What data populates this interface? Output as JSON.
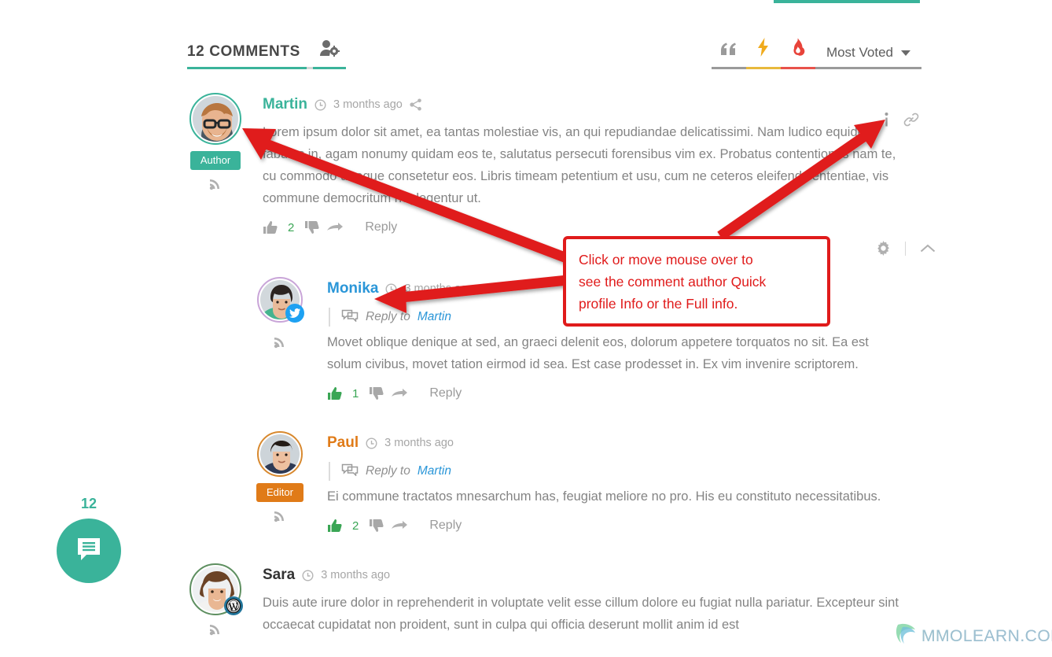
{
  "header": {
    "title": "12 COMMENTS",
    "user_settings_icon": "user-gear-icon",
    "quote_icon": "quote-icon",
    "bolt_icon": "lightning-icon",
    "flame_icon": "flame-icon",
    "sort_label": "Most Voted",
    "accent_color": "#3ab39a",
    "bolt_color": "#e8b93c",
    "flame_color": "#e8524a"
  },
  "comments": [
    {
      "id": "martin",
      "name": "Martin",
      "name_color": "#3ab39a",
      "timestamp": "3 months ago",
      "role_badge": "Author",
      "role_color": "#3ab39a",
      "avatar_border": "#3ab39a",
      "network_badge": null,
      "reply_to": null,
      "reply_to_name": null,
      "text": "Lorem ipsum dolor sit amet, ea tantas molestiae vis, an qui repudiandae delicatissimi. Nam ludico equidem fabulas in, agam nonumy quidam eos te, salutatus persecuti forensibus vim ex. Probatus contentiones nam te, cu commodo utroque consetetur eos. Libris timeam petentium et usu, cum ne ceteros eleifend sententiae, vis commune democritum neglegentur ut.",
      "vote_count": "2",
      "vote_up_active": false,
      "reply_label": "Reply",
      "has_share": true
    },
    {
      "id": "monika",
      "name": "Monika",
      "name_color": "#2a96d8",
      "timestamp": "3 months ago",
      "role_badge": null,
      "role_color": null,
      "avatar_border": "#c9a5d8",
      "network_badge": "twitter-icon",
      "reply_to": "Reply to",
      "reply_to_name": "Martin",
      "text": "Movet oblique denique at sed, an graeci delenit eos, dolorum appetere torquatos no sit. Ea est solum civibus, movet tation eirmod id sea. Est case prodesset in. Ex vim invenire scriptorem.",
      "vote_count": "1",
      "vote_up_active": true,
      "reply_label": "Reply",
      "has_share": false
    },
    {
      "id": "paul",
      "name": "Paul",
      "name_color": "#e07b18",
      "timestamp": "3 months ago",
      "role_badge": "Editor",
      "role_color": "#e07b18",
      "avatar_border": "#d8892f",
      "network_badge": null,
      "reply_to": "Reply to",
      "reply_to_name": "Martin",
      "text": "Ei commune tractatos mnesarchum has, feugiat meliore no pro. His eu constituto necessitatibus.",
      "vote_count": "2",
      "vote_up_active": true,
      "reply_label": "Reply",
      "has_share": false
    },
    {
      "id": "sara",
      "name": "Sara",
      "name_color": "#333333",
      "timestamp": "3 months ago",
      "role_badge": null,
      "role_color": null,
      "avatar_border": "#5e8f60",
      "network_badge": "wordpress-icon",
      "reply_to": null,
      "reply_to_name": null,
      "text": "Duis aute irure dolor in reprehenderit in voluptate velit esse cillum dolore eu fugiat nulla pariatur. Excepteur sint occaecat cupidatat non proident, sunt in culpa qui officia deserunt mollit anim id est",
      "vote_count": null,
      "vote_up_active": false,
      "reply_label": null,
      "has_share": false
    }
  ],
  "annotation": {
    "text_line1": "Click or move mouse over to",
    "text_line2": "see the comment author Quick",
    "text_line3": "profile Info or the Full info.",
    "color": "#e01b1b"
  },
  "floating_button": {
    "count": "12",
    "icon": "comment-bubble-icon",
    "color": "#3ab39a"
  },
  "watermark": {
    "text": "MMOLEARN.COM"
  }
}
